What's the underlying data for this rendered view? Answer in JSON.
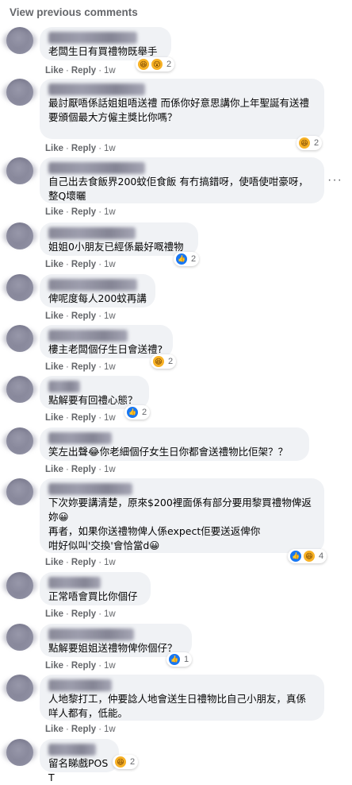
{
  "view_previous": "View previous comments",
  "action_like": "Like",
  "action_reply": "Reply",
  "separator": "·",
  "more_options": "···",
  "comments": [
    {
      "text": "老闆生日有買禮物既舉手",
      "time": "1w",
      "reactions": [
        "haha",
        "wow"
      ],
      "count": "2"
    },
    {
      "text": "最討厭唔係話姐姐唔送禮 而係你好意思講你上年聖誕有送禮\n要頒個最大方僱主獎比你嗎？",
      "time": "1w",
      "reactions": [
        "haha"
      ],
      "count": "2"
    },
    {
      "text": "自己出去食飯界200蚊佢食飯 有冇搞錯呀，使唔使咁豪呀，整Q壞曬",
      "time": "1w",
      "reactions": [],
      "count": ""
    },
    {
      "text": "姐姐0小朋友已經係最好嘅禮物",
      "time": "1w",
      "reactions": [
        "like"
      ],
      "count": "2"
    },
    {
      "text": "俾呢度每人200蚊再講",
      "time": "1w",
      "reactions": [],
      "count": ""
    },
    {
      "text": "樓主老闆個仔生日會送禮?",
      "time": "1w",
      "reactions": [
        "haha"
      ],
      "count": "2"
    },
    {
      "text": "點解要有回禮心態？",
      "time": "1w",
      "reactions": [
        "like"
      ],
      "count": "2"
    },
    {
      "text": "笑左出聲😂你老細個仔女生日你都會送禮物比佢架？？",
      "time": "1w",
      "reactions": [],
      "count": ""
    },
    {
      "text": "下次妳要講清楚，原來$200裡面係有部分要用黎買禮物俾返妳😀\n再者，如果你送禮物俾人係expect佢要送返俾你\n咁好似叫'交換'會恰當d😀",
      "time": "1w",
      "reactions": [
        "like",
        "haha"
      ],
      "count": "4"
    },
    {
      "text": "正常唔會買比你個仔",
      "time": "1w",
      "reactions": [],
      "count": ""
    },
    {
      "text": "點解要姐姐送禮物俾你個仔？",
      "time": "1w",
      "reactions": [
        "like"
      ],
      "count": "1"
    },
    {
      "text": "人地黎打工，仲要諗人地會送生日禮物比自己小朋友，真係咩人都有，低能。",
      "time": "1w",
      "reactions": [],
      "count": ""
    },
    {
      "text": "留名睇戲POST",
      "time": "",
      "reactions": [
        "haha"
      ],
      "count": "2"
    }
  ]
}
